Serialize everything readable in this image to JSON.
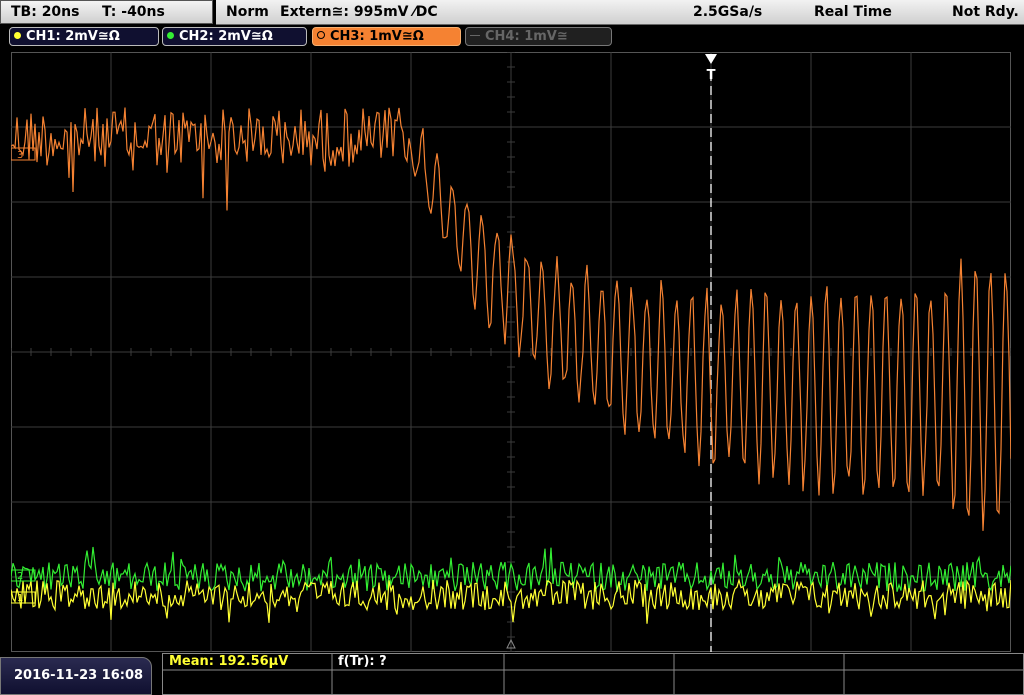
{
  "header": {
    "timebase": "TB: 20ns",
    "trigger_time": "T: -40ns",
    "mode": "Norm",
    "trigger_source": "Extern≅: 995mV ⁄DC",
    "sample_rate": "2.5GSa/s",
    "acq_mode": "Real Time",
    "status": "Not Rdy."
  },
  "channels": [
    {
      "label": "CH1: 2mV≅Ω",
      "color": "#ffff33",
      "active": true
    },
    {
      "label": "CH2: 2mV≅Ω",
      "color": "#33ee33",
      "active": true
    },
    {
      "label": "CH3: 1mV≅Ω",
      "color": "#f58232",
      "active": true
    },
    {
      "label": "CH4: 1mV≅",
      "color": "#666666",
      "active": false
    }
  ],
  "markers": {
    "trigger": "T",
    "ch3_ref": "3",
    "ch2_ref": "2",
    "ch1_ref": "1"
  },
  "footer": {
    "datetime": "2016-11-23 16:08",
    "mean": "Mean: 192.56µV",
    "ftr": "f(Tr): ?"
  },
  "colors": {
    "grid": "#3c3c3c",
    "ch1": "#ffff33",
    "ch2": "#33ee33",
    "ch3": "#f58232",
    "trigger_line": "#ffffff"
  }
}
